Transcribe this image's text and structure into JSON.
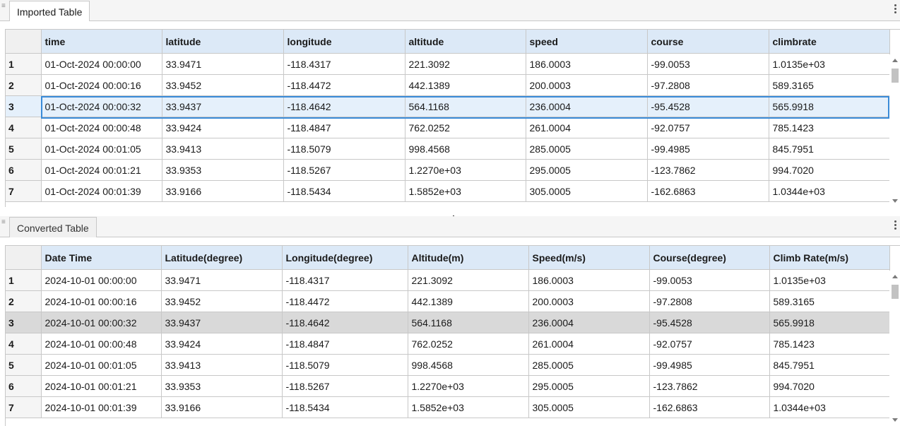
{
  "top": {
    "tab_label": "Imported Table",
    "columns": [
      "time",
      "latitude",
      "longitude",
      "altitude",
      "speed",
      "course",
      "climbrate"
    ],
    "rows": [
      {
        "n": "1",
        "cells": [
          "01-Oct-2024 00:00:00",
          "33.9471",
          "-118.4317",
          "221.3092",
          "186.0003",
          "-99.0053",
          "1.0135e+03"
        ]
      },
      {
        "n": "2",
        "cells": [
          "01-Oct-2024 00:00:16",
          "33.9452",
          "-118.4472",
          "442.1389",
          "200.0003",
          "-97.2808",
          "589.3165"
        ]
      },
      {
        "n": "3",
        "cells": [
          "01-Oct-2024 00:00:32",
          "33.9437",
          "-118.4642",
          "564.1168",
          "236.0004",
          "-95.4528",
          "565.9918"
        ]
      },
      {
        "n": "4",
        "cells": [
          "01-Oct-2024 00:00:48",
          "33.9424",
          "-118.4847",
          "762.0252",
          "261.0004",
          "-92.0757",
          "785.1423"
        ]
      },
      {
        "n": "5",
        "cells": [
          "01-Oct-2024 00:01:05",
          "33.9413",
          "-118.5079",
          "998.4568",
          "285.0005",
          "-99.4985",
          "845.7951"
        ]
      },
      {
        "n": "6",
        "cells": [
          "01-Oct-2024 00:01:21",
          "33.9353",
          "-118.5267",
          "1.2270e+03",
          "295.0005",
          "-123.7862",
          "994.7020"
        ]
      },
      {
        "n": "7",
        "cells": [
          "01-Oct-2024 00:01:39",
          "33.9166",
          "-118.5434",
          "1.5852e+03",
          "305.0005",
          "-162.6863",
          "1.0344e+03"
        ]
      }
    ]
  },
  "bottom": {
    "tab_label": "Converted Table",
    "columns": [
      "Date Time",
      "Latitude(degree)",
      "Longitude(degree)",
      "Altitude(m)",
      "Speed(m/s)",
      "Course(degree)",
      "Climb Rate(m/s)"
    ],
    "rows": [
      {
        "n": "1",
        "cells": [
          "2024-10-01 00:00:00",
          "33.9471",
          "-118.4317",
          "221.3092",
          "186.0003",
          "-99.0053",
          "1.0135e+03"
        ]
      },
      {
        "n": "2",
        "cells": [
          "2024-10-01 00:00:16",
          "33.9452",
          "-118.4472",
          "442.1389",
          "200.0003",
          "-97.2808",
          "589.3165"
        ]
      },
      {
        "n": "3",
        "cells": [
          "2024-10-01 00:00:32",
          "33.9437",
          "-118.4642",
          "564.1168",
          "236.0004",
          "-95.4528",
          "565.9918"
        ]
      },
      {
        "n": "4",
        "cells": [
          "2024-10-01 00:00:48",
          "33.9424",
          "-118.4847",
          "762.0252",
          "261.0004",
          "-92.0757",
          "785.1423"
        ]
      },
      {
        "n": "5",
        "cells": [
          "2024-10-01 00:01:05",
          "33.9413",
          "-118.5079",
          "998.4568",
          "285.0005",
          "-99.4985",
          "845.7951"
        ]
      },
      {
        "n": "6",
        "cells": [
          "2024-10-01 00:01:21",
          "33.9353",
          "-118.5267",
          "1.2270e+03",
          "295.0005",
          "-123.7862",
          "994.7020"
        ]
      },
      {
        "n": "7",
        "cells": [
          "2024-10-01 00:01:39",
          "33.9166",
          "-118.5434",
          "1.5852e+03",
          "305.0005",
          "-162.6863",
          "1.0344e+03"
        ]
      }
    ]
  },
  "selected_row": "3",
  "icons": {
    "grip": "grip-icon",
    "more": "more-options-icon",
    "cursor": "mouse-pointer-icon"
  },
  "colors": {
    "header_bg": "#dce9f7",
    "selection_border": "#3a8bd8",
    "selection_bg": "#e5f0fb",
    "highlight_bg": "#d9d9d9",
    "cursor": "#c8d42a"
  }
}
